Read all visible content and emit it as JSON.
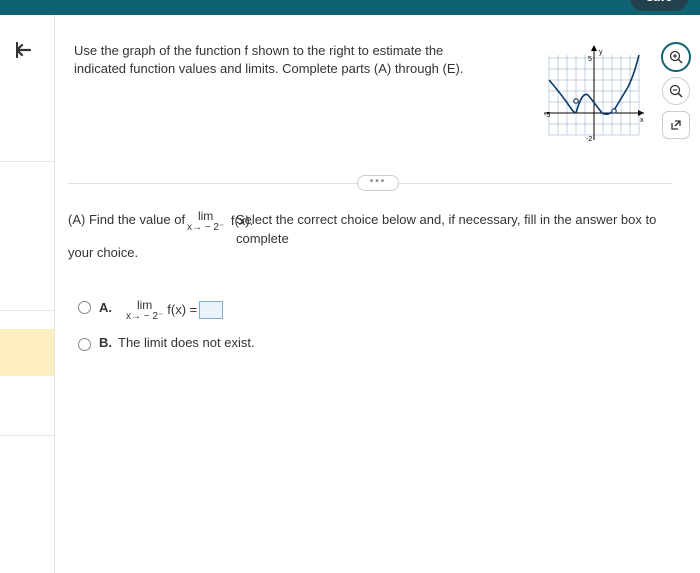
{
  "header": {
    "save_label": "Save"
  },
  "nav": {
    "back_glyph": "❮"
  },
  "prompt": {
    "text": "Use the graph of the function f shown to the right to estimate the indicated function values and limits. Complete parts (A) through (E)."
  },
  "graph": {
    "x_label": "x",
    "y_label": "y",
    "x_min": -5,
    "x_max": 5,
    "y_min": -2,
    "y_max": 5,
    "ticks": {
      "x_left": "-5",
      "y_top": "5",
      "y_bottom": "-2"
    }
  },
  "tools": {
    "zoom_in": "⊕",
    "zoom_out": "⊖",
    "popout": "↗"
  },
  "expand_dots": "•••",
  "question": {
    "part_label": "(A) Find the value of",
    "limit_top": "lim",
    "limit_func": "f(x).",
    "limit_sub": "x→ − 2⁻",
    "after": "Select the correct choice below and, if necessary, fill in the answer box to complete",
    "line2": "your choice."
  },
  "choices": {
    "a": {
      "letter": "A.",
      "lim_top": "lim",
      "lim_sub": "x→ − 2⁻",
      "func_eq": "f(x) ="
    },
    "b": {
      "letter": "B.",
      "text": "The limit does not exist."
    }
  },
  "chart_data": {
    "type": "line",
    "title": "",
    "xlabel": "x",
    "ylabel": "y",
    "xlim": [
      -5,
      5
    ],
    "ylim": [
      -2,
      5
    ],
    "series": [
      {
        "name": "f",
        "x": [
          -5,
          -4,
          -3,
          -2,
          -1,
          0,
          1,
          2,
          3,
          4,
          5
        ],
        "values": [
          3,
          2,
          0.5,
          0,
          2,
          1,
          0,
          0,
          1,
          2,
          5
        ]
      }
    ],
    "annotations": [
      "open circle near x = -2",
      "open circle near x = 2"
    ]
  }
}
